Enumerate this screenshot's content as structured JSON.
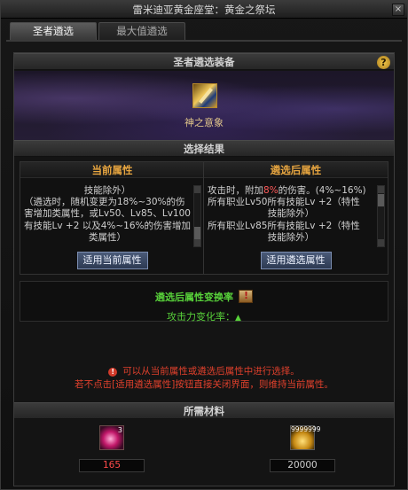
{
  "window": {
    "title": "雷米迪亚黄金座堂：黄金之祭坛",
    "close_label": "×"
  },
  "tabs": [
    {
      "label": "圣者遴选"
    },
    {
      "label": "最大值遴选"
    }
  ],
  "equipment_section": {
    "title": "圣者遴选装备",
    "help_label": "?",
    "item_name": "神之意象",
    "item_icon": "item-weapon-icon"
  },
  "result_section": {
    "title": "选择结果"
  },
  "current": {
    "title": "当前属性",
    "lines": [
      "技能除外）",
      "（遴选时，随机变更为18%~30%的伤",
      "害增加类属性，或Lv50、Lv85、Lv100所",
      "有技能Lv +2 以及4%~16%的伤害增加",
      "类属性）"
    ],
    "button": "适用当前属性"
  },
  "selected": {
    "title": "遴选后属性",
    "line1_prefix": "攻击时，附加",
    "line1_value": "8%",
    "line1_suffix": "的伤害。(4%~16%)",
    "lines": [
      "所有职业Lv50所有技能Lv +2（特性",
      "技能除外）",
      "所有职业Lv85所有技能Lv +2（特性",
      "技能除外）"
    ],
    "button": "适用遴选属性"
  },
  "change_rate": {
    "title": "遴选后属性变换率",
    "attack_label": "攻击力变化率：",
    "arrow": "▲"
  },
  "notice": {
    "line1": "可以从当前属性或遴选后属性中进行选择。",
    "line2": "若不点击[适用遴选属性]按钮直接关闭界面，则维持当前属性。"
  },
  "materials_section": {
    "title": "所需材料"
  },
  "materials": [
    {
      "icon": "orb-material-icon",
      "badge": "3",
      "count": "165",
      "status_color": "#ff4a4a"
    },
    {
      "icon": "gold-coin-icon",
      "badge": "9999999",
      "count": "20000",
      "status_color": "#cfcfcf"
    }
  ]
}
